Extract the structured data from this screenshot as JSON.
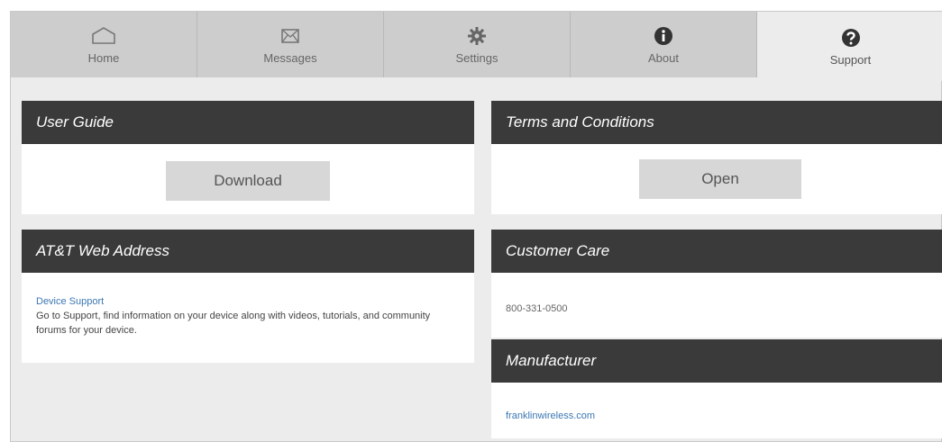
{
  "tabs": [
    {
      "label": "Home",
      "icon": "home-icon",
      "active": false
    },
    {
      "label": "Messages",
      "icon": "envelope-icon",
      "active": false
    },
    {
      "label": "Settings",
      "icon": "gear-icon",
      "active": false
    },
    {
      "label": "About",
      "icon": "info-icon",
      "active": false
    },
    {
      "label": "Support",
      "icon": "question-icon",
      "active": true
    }
  ],
  "user_guide": {
    "title": "User Guide",
    "button": "Download"
  },
  "terms": {
    "title": "Terms and Conditions",
    "button": "Open"
  },
  "web_address": {
    "title": "AT&T Web Address",
    "link": "Device Support",
    "description": "Go to Support, find information on your device along with videos, tutorials, and community forums for your device."
  },
  "customer_care": {
    "title": "Customer Care",
    "phone": "800-331-0500"
  },
  "manufacturer": {
    "title": "Manufacturer",
    "link": "franklinwireless.com"
  },
  "colors": {
    "header": "#3a3a3a",
    "tab_bg": "#cdcdcd",
    "link": "#3b77b3"
  }
}
